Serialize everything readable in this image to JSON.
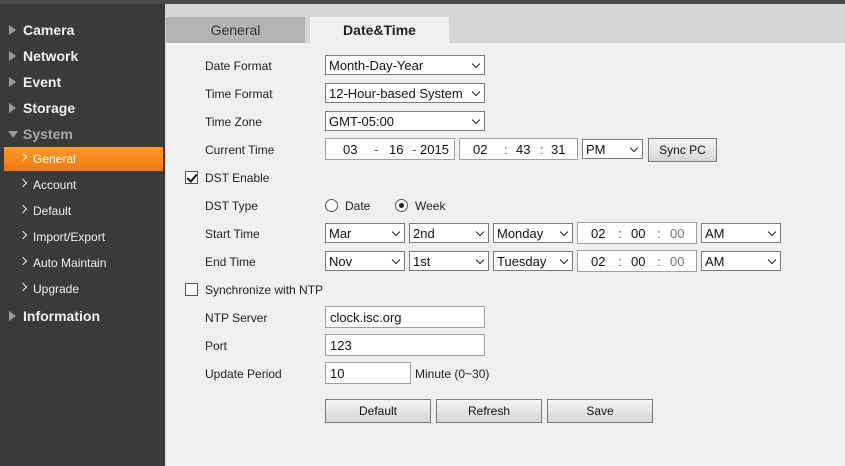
{
  "sidebar": {
    "main": [
      "Camera",
      "Network",
      "Event",
      "Storage",
      "System",
      "Information"
    ],
    "sub": [
      "General",
      "Account",
      "Default",
      "Import/Export",
      "Auto Maintain",
      "Upgrade"
    ]
  },
  "tabs": {
    "general": "General",
    "datetime": "Date&Time"
  },
  "form": {
    "date_format": {
      "label": "Date Format",
      "value": "Month-Day-Year"
    },
    "time_format": {
      "label": "Time Format",
      "value": "12-Hour-based System"
    },
    "time_zone": {
      "label": "Time Zone",
      "value": "GMT-05:00"
    },
    "current_time": {
      "label": "Current Time",
      "month": "03",
      "day": "16",
      "year": "2015",
      "hour": "02",
      "minute": "43",
      "second": "31",
      "ampm": "PM",
      "sync_label": "Sync PC"
    },
    "dst_enable": {
      "label": "DST Enable",
      "checked": true
    },
    "dst_type": {
      "label": "DST Type",
      "opt_date": "Date",
      "opt_week": "Week",
      "selected": "Week"
    },
    "start_time": {
      "label": "Start Time",
      "month": "Mar",
      "week": "2nd",
      "weekday": "Monday",
      "hour": "02",
      "minute": "00",
      "second": "00",
      "ampm": "AM"
    },
    "end_time": {
      "label": "End Time",
      "month": "Nov",
      "week": "1st",
      "weekday": "Tuesday",
      "hour": "02",
      "minute": "00",
      "second": "00",
      "ampm": "AM"
    },
    "ntp_sync": {
      "label": "Synchronize with NTP",
      "checked": false
    },
    "ntp_server": {
      "label": "NTP Server",
      "value": "clock.isc.org"
    },
    "port": {
      "label": "Port",
      "value": "123"
    },
    "update_period": {
      "label": "Update Period",
      "value": "10",
      "unit": "Minute (0~30)"
    }
  },
  "buttons": {
    "default": "Default",
    "refresh": "Refresh",
    "save": "Save"
  },
  "sep": {
    "dash": "-",
    "colon": ":"
  }
}
